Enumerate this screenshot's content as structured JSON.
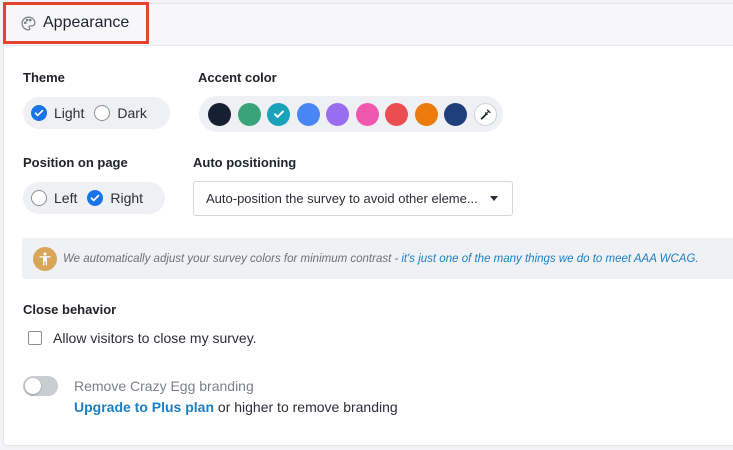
{
  "header": {
    "title": "Appearance",
    "icon": "palette-icon"
  },
  "theme": {
    "label": "Theme",
    "options": [
      {
        "label": "Light",
        "selected": true
      },
      {
        "label": "Dark",
        "selected": false
      }
    ]
  },
  "accent": {
    "label": "Accent color",
    "selected_index": 2,
    "colors": [
      "#172033",
      "#3aa37a",
      "#1aa3b8",
      "#4a86f3",
      "#9a6cf0",
      "#f057ae",
      "#ea4d52",
      "#ec7a0c",
      "#1e3f7a"
    ],
    "picker_icon": "eyedropper-icon"
  },
  "position": {
    "label": "Position on page",
    "options": [
      {
        "label": "Left",
        "selected": false
      },
      {
        "label": "Right",
        "selected": true
      }
    ]
  },
  "auto_positioning": {
    "label": "Auto positioning",
    "value": "Auto-position the survey to avoid other eleme..."
  },
  "note": {
    "icon": "accessibility-icon",
    "text": "We automatically adjust your survey colors for minimum contrast -",
    "link": "it's just one of the many things we do to meet AAA WCAG."
  },
  "close_behavior": {
    "label": "Close behavior",
    "checkbox_label": "Allow visitors to close my survey.",
    "checked": false
  },
  "branding": {
    "toggle_label": "Remove Crazy Egg branding",
    "enabled": false,
    "upgrade_link": "Upgrade to Plus plan",
    "upgrade_suffix": "or higher to remove branding"
  },
  "colors": {
    "highlight_border": "#e4432d",
    "primary": "#1a73e8",
    "link": "#1b7fc4"
  }
}
